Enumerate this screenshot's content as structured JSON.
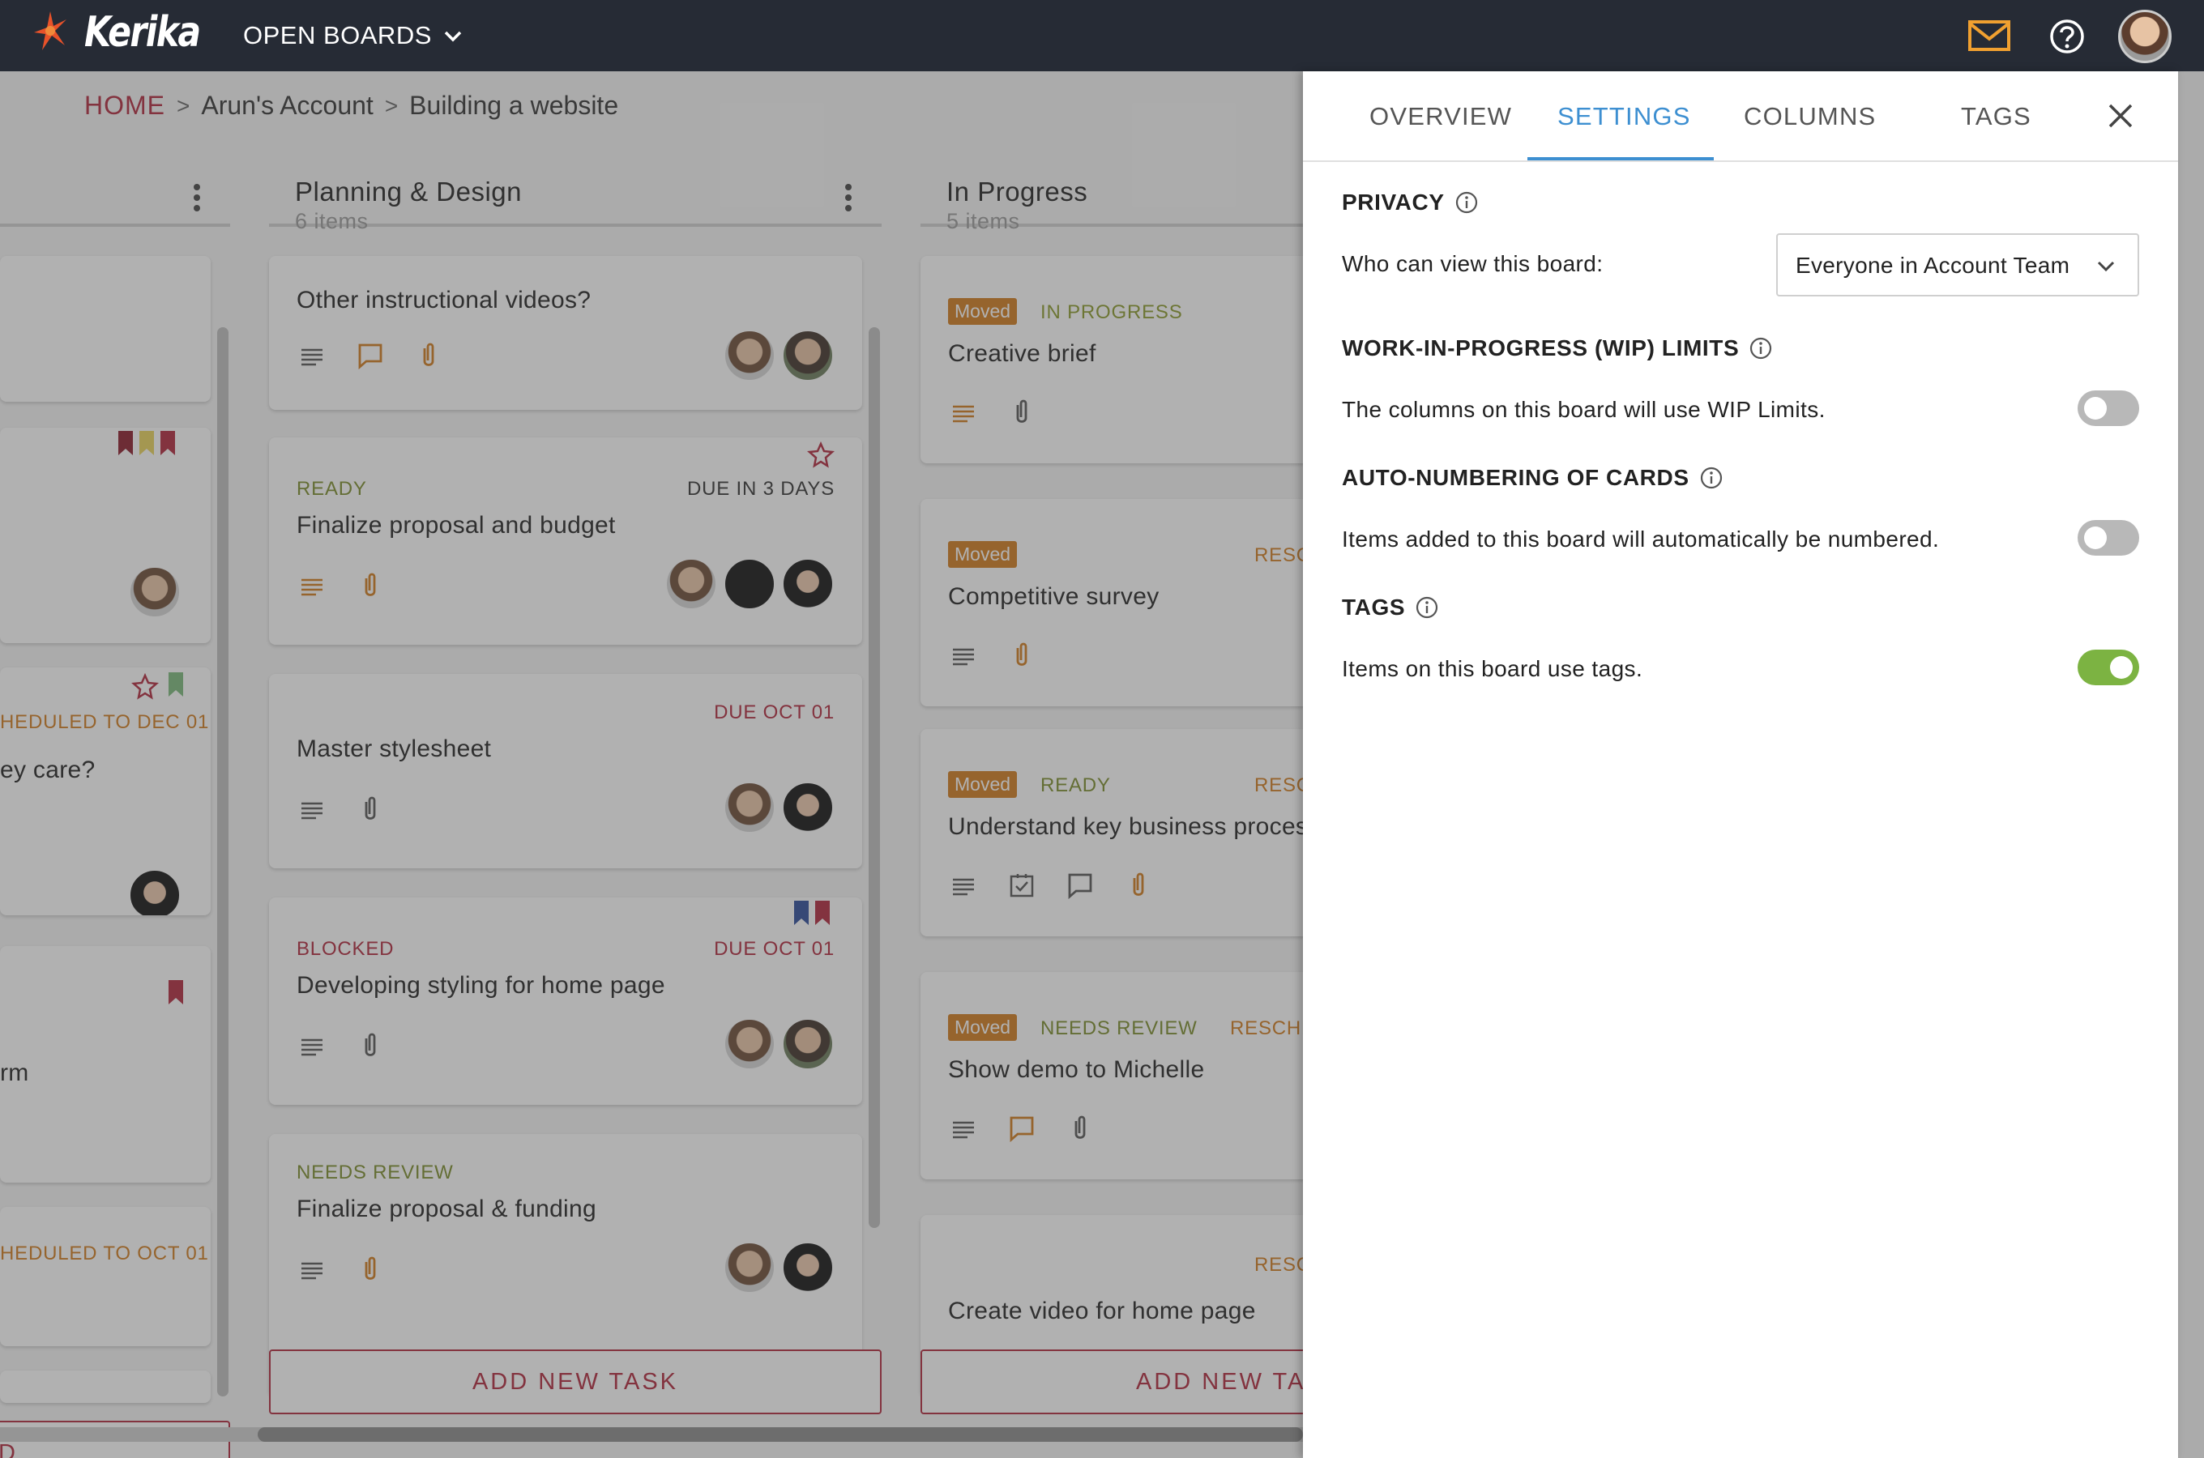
{
  "app": {
    "name": "Kerika",
    "open_boards_label": "OPEN BOARDS"
  },
  "colors": {
    "accent": "#3d8fd1",
    "brand_red": "#b0263b",
    "orange": "#d07a1c",
    "toggle_on": "#7cb342"
  },
  "breadcrumb": {
    "home": "HOME",
    "account": "Arun's Account",
    "board": "Building a website"
  },
  "columns": [
    {
      "title": "Planning & Design",
      "count": "6 items"
    },
    {
      "title": "In Progress",
      "count": "5 items"
    }
  ],
  "left_column": {
    "partial_cards": [
      {
        "status": "HEDULED TO DEC 01",
        "title": "ey care?"
      },
      {
        "title": "rm"
      },
      {
        "status": "HEDULED TO OCT 01"
      }
    ],
    "add_label": "D"
  },
  "planning_cards": [
    {
      "title": "Other instructional videos?",
      "status": "",
      "due": ""
    },
    {
      "title": "Finalize proposal and budget",
      "status": "READY",
      "due": "DUE IN 3 DAYS"
    },
    {
      "title": "Master stylesheet",
      "status": "",
      "due": "DUE OCT 01"
    },
    {
      "title": "Developing styling for home page",
      "status": "BLOCKED",
      "due": "DUE OCT 01"
    },
    {
      "title": "Finalize proposal & funding",
      "status": "NEEDS REVIEW",
      "due": ""
    }
  ],
  "progress_cards": [
    {
      "moved": "Moved",
      "status": "IN PROGRESS",
      "title": "Creative brief",
      "resc": ""
    },
    {
      "moved": "Moved",
      "status": "",
      "title": "Competitive survey",
      "resc": "RESC"
    },
    {
      "moved": "Moved",
      "status": "READY",
      "title": "Understand key business proces",
      "resc": "RESC"
    },
    {
      "moved": "Moved",
      "status": "NEEDS REVIEW",
      "title": "Show demo to Michelle",
      "resc": "RESCHE"
    },
    {
      "moved": "",
      "status": "",
      "title": "Create video for home page",
      "resc": "RESC"
    }
  ],
  "add_task_label": "ADD NEW TASK",
  "add_task_label_partial": "ADD NEW TAS",
  "panel": {
    "tabs": [
      "OVERVIEW",
      "SETTINGS",
      "COLUMNS",
      "TAGS"
    ],
    "active_tab": "SETTINGS",
    "privacy": {
      "title": "PRIVACY",
      "label": "Who can view this board:",
      "selected": "Everyone in Account Team"
    },
    "wip": {
      "title": "WORK-IN-PROGRESS (WIP) LIMITS",
      "text": "The columns on this board will use WIP Limits.",
      "enabled": false
    },
    "auto_numbering": {
      "title": "AUTO-NUMBERING OF CARDS",
      "text": "Items added to this board will automatically be numbered.",
      "enabled": false
    },
    "tags": {
      "title": "TAGS",
      "text": "Items on this board use tags.",
      "enabled": true
    }
  }
}
